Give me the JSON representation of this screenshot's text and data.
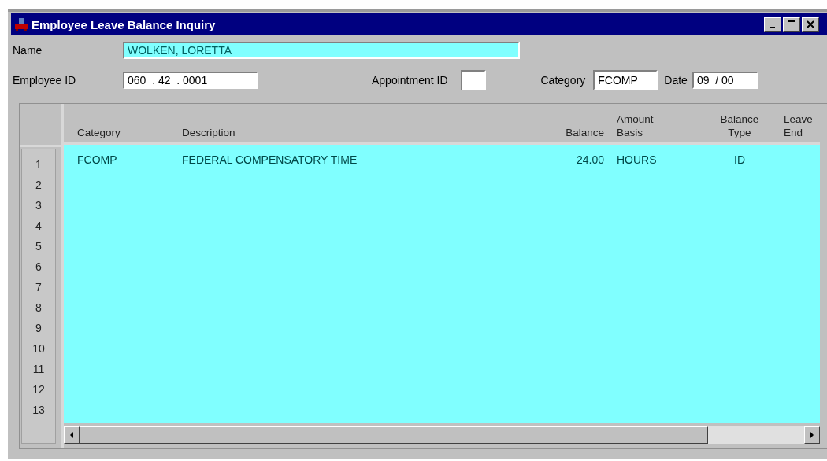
{
  "window": {
    "title": "Employee Leave Balance Inquiry"
  },
  "fields": {
    "name": {
      "label": "Name",
      "value": "WOLKEN, LORETTA"
    },
    "employee_id": {
      "label": "Employee ID",
      "value": "060  . 42  . 0001"
    },
    "appointment_id": {
      "label": "Appointment ID"
    },
    "category": {
      "label": "Category",
      "value": "FCOMP"
    },
    "date": {
      "label": "Date",
      "value": "09  / 00"
    }
  },
  "table": {
    "columns": [
      {
        "lines": [
          "Category"
        ]
      },
      {
        "lines": [
          "Description"
        ]
      },
      {
        "lines": [
          "Balance"
        ]
      },
      {
        "lines": [
          "Amount",
          "Basis"
        ]
      },
      {
        "lines": [
          "Balance",
          "Type"
        ]
      },
      {
        "lines": [
          "Leave",
          "End"
        ]
      }
    ],
    "rows": [
      {
        "number": "1",
        "cells": [
          "FCOMP",
          "FEDERAL COMPENSATORY TIME",
          "24.00",
          "HOURS",
          "ID",
          ""
        ]
      },
      {
        "number": "2"
      },
      {
        "number": "3"
      },
      {
        "number": "4"
      },
      {
        "number": "5"
      },
      {
        "number": "6"
      },
      {
        "number": "7"
      },
      {
        "number": "8"
      },
      {
        "number": "9"
      },
      {
        "number": "10"
      },
      {
        "number": "11"
      },
      {
        "number": "12"
      },
      {
        "number": "13"
      }
    ]
  }
}
